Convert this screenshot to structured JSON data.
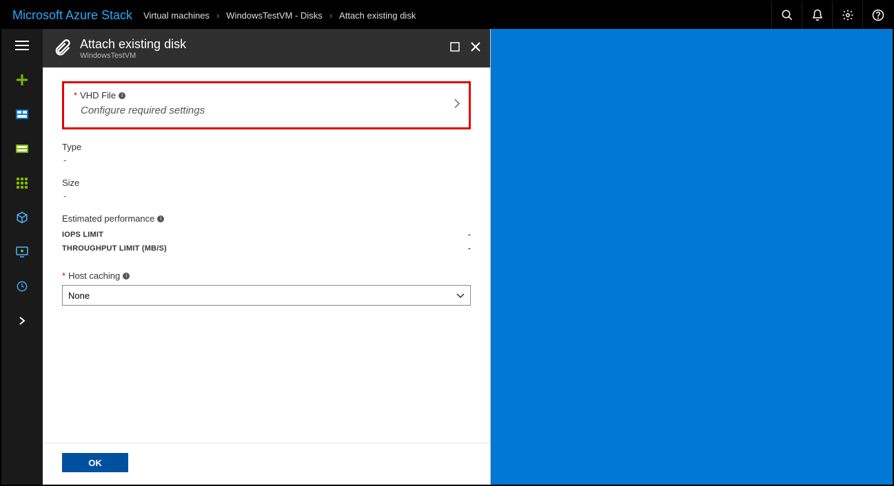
{
  "brand": "Microsoft Azure Stack",
  "breadcrumb": [
    "Virtual machines",
    "WindowsTestVM - Disks",
    "Attach existing disk"
  ],
  "blade": {
    "title": "Attach existing disk",
    "subtitle": "WindowsTestVM",
    "vhd": {
      "label": "VHD File",
      "placeholder": "Configure required settings"
    },
    "type": {
      "label": "Type",
      "value": "-"
    },
    "size": {
      "label": "Size",
      "value": "-"
    },
    "perf": {
      "label": "Estimated performance",
      "rows": [
        {
          "name": "IOPS LIMIT",
          "value": "-"
        },
        {
          "name": "THROUGHPUT LIMIT (MB/S)",
          "value": "-"
        }
      ]
    },
    "hostCaching": {
      "label": "Host caching",
      "value": "None"
    },
    "ok": "OK"
  }
}
